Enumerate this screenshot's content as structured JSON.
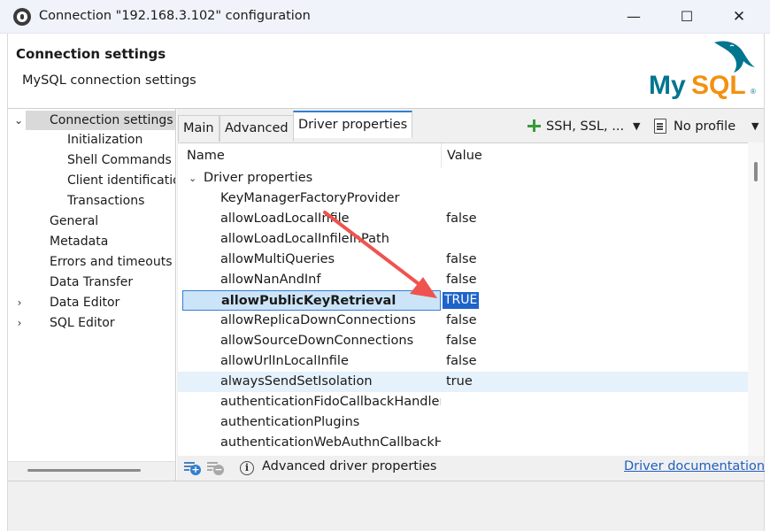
{
  "window": {
    "title": "Connection \"192.168.3.102\" configuration",
    "minimize": "—",
    "maximize": "☐",
    "close": "✕"
  },
  "header": {
    "title": "Connection settings",
    "subtitle": "MySQL connection settings",
    "logo_text": "MySQL",
    "logo_mark": "®"
  },
  "tree": {
    "items": [
      {
        "label": "Connection settings",
        "expanded": true,
        "selected": true
      },
      {
        "label": "Initialization"
      },
      {
        "label": "Shell Commands"
      },
      {
        "label": "Client identification"
      },
      {
        "label": "Transactions"
      },
      {
        "label": "General"
      },
      {
        "label": "Metadata"
      },
      {
        "label": "Errors and timeouts"
      },
      {
        "label": "Data Transfer"
      },
      {
        "label": "Data Editor",
        "expandable": true
      },
      {
        "label": "SQL Editor",
        "expandable": true
      }
    ]
  },
  "tabs": [
    {
      "label": "Main"
    },
    {
      "label": "Advanced"
    },
    {
      "label": "Driver properties",
      "active": true
    }
  ],
  "toolbar": {
    "network_label": "SSH, SSL, ...",
    "profile_label": "No profile"
  },
  "grid": {
    "columns": {
      "name": "Name",
      "value": "Value"
    },
    "group_label": "Driver properties",
    "rows": [
      {
        "name": "KeyManagerFactoryProvider",
        "value": ""
      },
      {
        "name": "allowLoadLocalInfile",
        "value": "false"
      },
      {
        "name": "allowLoadLocalInfileInPath",
        "value": ""
      },
      {
        "name": "allowMultiQueries",
        "value": "false"
      },
      {
        "name": "allowNanAndInf",
        "value": "false"
      },
      {
        "name": "allowPublicKeyRetrieval",
        "value": "TRUE",
        "selected": true
      },
      {
        "name": "allowReplicaDownConnections",
        "value": "false"
      },
      {
        "name": "allowSourceDownConnections",
        "value": "false"
      },
      {
        "name": "allowUrlInLocalInfile",
        "value": "false"
      },
      {
        "name": "alwaysSendSetIsolation",
        "value": "true",
        "hover": true
      },
      {
        "name": "authenticationFidoCallbackHandler",
        "value": ""
      },
      {
        "name": "authenticationPlugins",
        "value": ""
      },
      {
        "name": "authenticationWebAuthnCallbackHandler",
        "value": ""
      }
    ]
  },
  "bottom": {
    "info_text": "Advanced driver properties",
    "doc_link": "Driver documentation"
  },
  "colors": {
    "accent": "#2f7fd0",
    "selection": "#1e63c8",
    "annotation_arrow": "#ef5350",
    "mysql_blue": "#00758f",
    "mysql_orange": "#f29111"
  },
  "icons": [
    "app-icon",
    "chevron-down-icon",
    "chevron-right-icon",
    "plus-icon",
    "document-icon",
    "add-property-icon",
    "remove-property-icon",
    "info-icon",
    "dropdown-icon",
    "arrow-annotation"
  ]
}
